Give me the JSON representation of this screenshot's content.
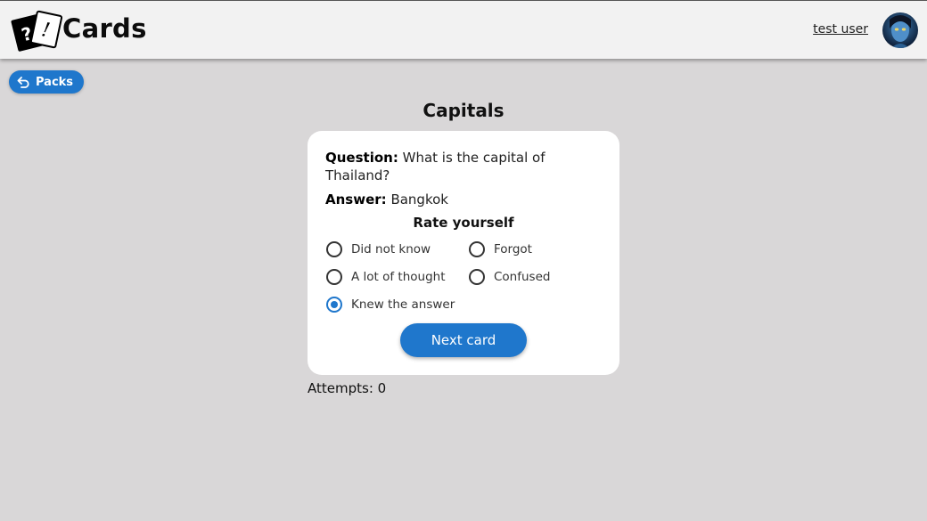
{
  "header": {
    "app_title": "Cards",
    "user_name": "test user",
    "logo_front_glyph": "!",
    "logo_back_glyph": "?"
  },
  "nav": {
    "back_label": "Packs"
  },
  "pack": {
    "title": "Capitals"
  },
  "card": {
    "question_label": "Question:",
    "question_text": "What is the capital of Thailand?",
    "answer_label": "Answer:",
    "answer_text": "Bangkok",
    "rate_title": "Rate yourself",
    "options": [
      {
        "label": "Did not know",
        "checked": false
      },
      {
        "label": "Forgot",
        "checked": false
      },
      {
        "label": "A lot of thought",
        "checked": false
      },
      {
        "label": "Confused",
        "checked": false
      },
      {
        "label": "Knew the answer",
        "checked": true
      }
    ],
    "next_label": "Next card"
  },
  "stats": {
    "attempts_label": "Attempts:",
    "attempts_value": "0"
  },
  "colors": {
    "accent": "#1f77cc",
    "background": "#d9d7d8",
    "header": "#f2f2f2"
  }
}
